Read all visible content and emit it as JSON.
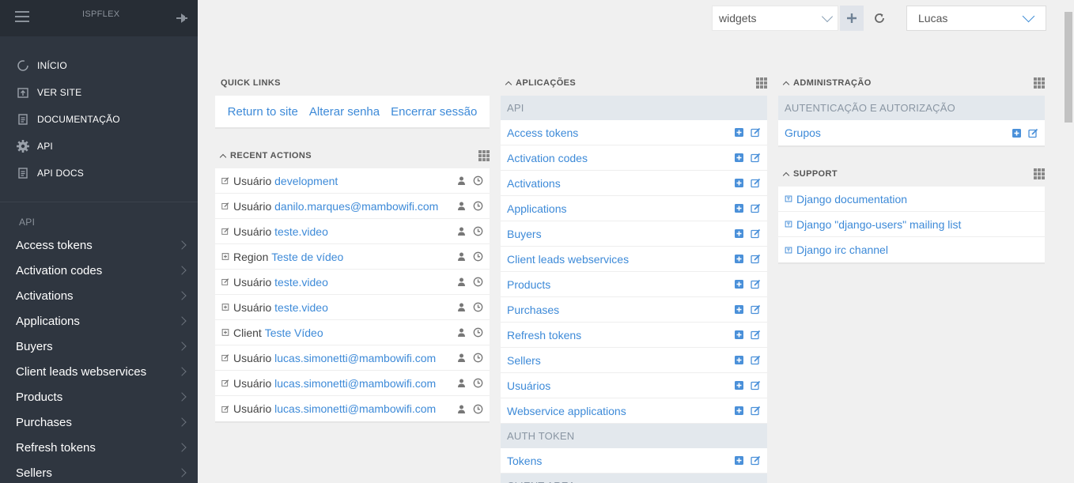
{
  "brand": "ISPFLEX",
  "nav": [
    {
      "label": "INÍCIO",
      "icon": "home-circle-icon"
    },
    {
      "label": "VER SITE",
      "icon": "open-site-icon"
    },
    {
      "label": "DOCUMENTAÇÃO",
      "icon": "document-icon"
    },
    {
      "label": "API",
      "icon": "gear-icon"
    },
    {
      "label": "API DOCS",
      "icon": "document-icon"
    }
  ],
  "sidebar_section": "API",
  "sidebar_models": [
    "Access tokens",
    "Activation codes",
    "Activations",
    "Applications",
    "Buyers",
    "Client leads webservices",
    "Products",
    "Purchases",
    "Refresh tokens",
    "Sellers"
  ],
  "topbar": {
    "widgets_value": "widgets",
    "user_value": "Lucas"
  },
  "quick_links": {
    "title": "QUICK LINKS",
    "links": [
      "Return to site",
      "Alterar senha",
      "Encerrar sessão"
    ]
  },
  "recent_actions": {
    "title": "RECENT ACTIONS",
    "items": [
      {
        "type": "change",
        "model": "Usuário",
        "object": "development"
      },
      {
        "type": "change",
        "model": "Usuário",
        "object": "danilo.marques@mambowifi.com"
      },
      {
        "type": "change",
        "model": "Usuário",
        "object": "teste.video"
      },
      {
        "type": "add",
        "model": "Region",
        "object": "Teste de vídeo"
      },
      {
        "type": "change",
        "model": "Usuário",
        "object": "teste.video"
      },
      {
        "type": "add",
        "model": "Usuário",
        "object": "teste.video"
      },
      {
        "type": "add",
        "model": "Client",
        "object": "Teste Vídeo"
      },
      {
        "type": "change",
        "model": "Usuário",
        "object": "lucas.simonetti@mambowifi.com"
      },
      {
        "type": "change",
        "model": "Usuário",
        "object": "lucas.simonetti@mambowifi.com"
      },
      {
        "type": "change",
        "model": "Usuário",
        "object": "lucas.simonetti@mambowifi.com"
      }
    ]
  },
  "aplicacoes": {
    "title": "APLICAÇÕES",
    "groups": [
      {
        "name": "API",
        "models": [
          "Access tokens",
          "Activation codes",
          "Activations",
          "Applications",
          "Buyers",
          "Client leads webservices",
          "Products",
          "Purchases",
          "Refresh tokens",
          "Sellers",
          "Usuários",
          "Webservice applications"
        ]
      },
      {
        "name": "AUTH TOKEN",
        "models": [
          "Tokens"
        ]
      },
      {
        "name": "CLIENT AREA",
        "models": []
      }
    ]
  },
  "administracao": {
    "title": "ADMINISTRAÇÃO",
    "groups": [
      {
        "name": "AUTENTICAÇÃO E AUTORIZAÇÃO",
        "models": [
          "Grupos"
        ]
      }
    ]
  },
  "support": {
    "title": "SUPPORT",
    "links": [
      "Django documentation",
      "Django \"django-users\" mailing list",
      "Django irc channel"
    ]
  },
  "colors": {
    "sidebar": "#2f3640",
    "link": "#3d8ad8",
    "group_bg": "#e3e8ed"
  }
}
